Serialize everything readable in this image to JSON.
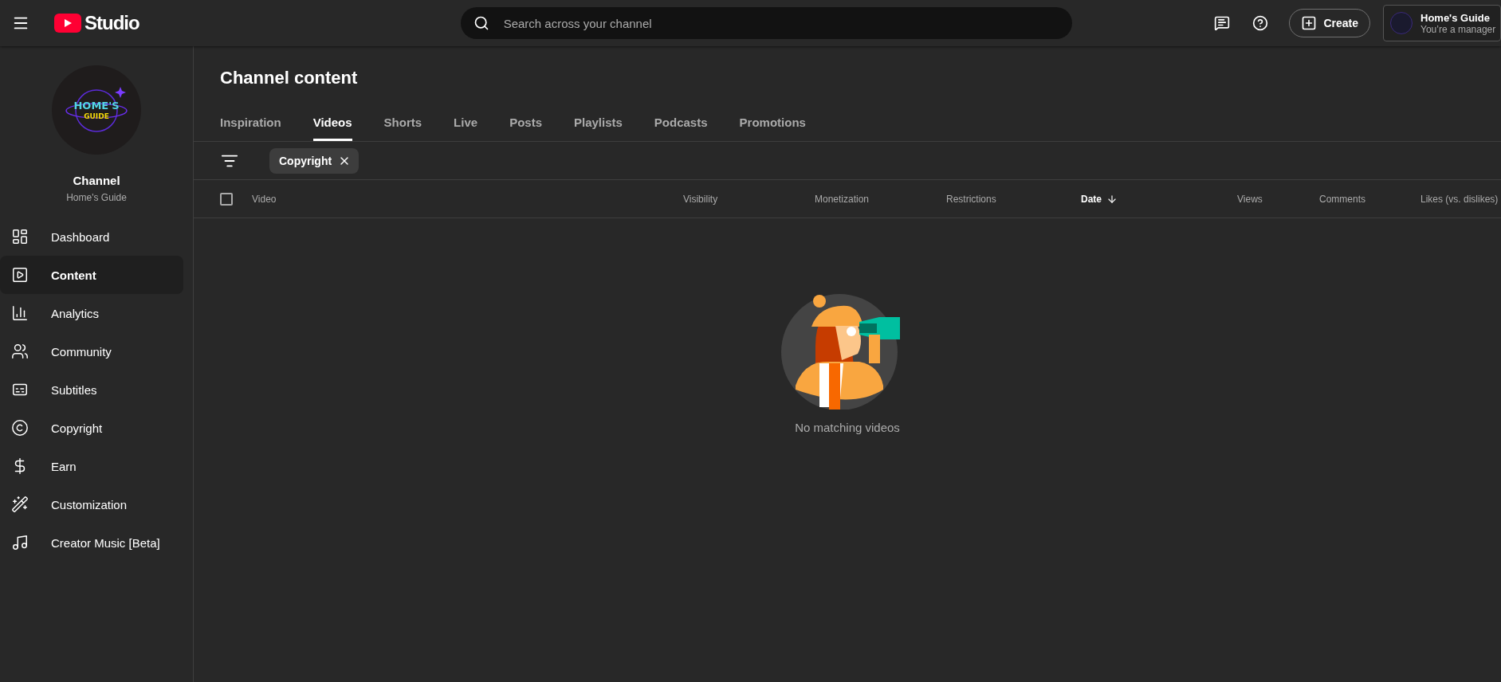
{
  "topbar": {
    "logo_text": "Studio",
    "search": {
      "placeholder": "Search across your channel"
    },
    "create_label": "Create",
    "account": {
      "name": "Home's Guide",
      "role": "You’re a manager"
    }
  },
  "sidebar": {
    "avatar_text": "HOME'S",
    "avatar_subtext": "GUIDE",
    "title": "Channel",
    "subtitle": "Home's Guide",
    "items": [
      {
        "label": "Dashboard",
        "kind": "dashboard",
        "selected": false
      },
      {
        "label": "Content",
        "kind": "content",
        "selected": true
      },
      {
        "label": "Analytics",
        "kind": "analytics",
        "selected": false
      },
      {
        "label": "Community",
        "kind": "community",
        "selected": false
      },
      {
        "label": "Subtitles",
        "kind": "subtitles",
        "selected": false
      },
      {
        "label": "Copyright",
        "kind": "copyright",
        "selected": false
      },
      {
        "label": "Earn",
        "kind": "earn",
        "selected": false
      },
      {
        "label": "Customization",
        "kind": "customization",
        "selected": false
      },
      {
        "label": "Creator Music [Beta]",
        "kind": "music",
        "selected": false
      }
    ]
  },
  "page_title": "Channel content",
  "tabs": [
    {
      "label": "Inspiration",
      "selected": false
    },
    {
      "label": "Videos",
      "selected": true
    },
    {
      "label": "Shorts",
      "selected": false
    },
    {
      "label": "Live",
      "selected": false
    },
    {
      "label": "Posts",
      "selected": false
    },
    {
      "label": "Playlists",
      "selected": false
    },
    {
      "label": "Podcasts",
      "selected": false
    },
    {
      "label": "Promotions",
      "selected": false
    }
  ],
  "filters": [
    {
      "label": "Copyright"
    }
  ],
  "table": {
    "select_all_checked": false,
    "columns": [
      {
        "label": "Video",
        "sorted": false
      },
      {
        "label": "Visibility",
        "sorted": false
      },
      {
        "label": "Monetization",
        "sorted": false
      },
      {
        "label": "Restrictions",
        "sorted": false
      },
      {
        "label": "Date",
        "sorted": true
      },
      {
        "label": "Views",
        "sorted": false
      },
      {
        "label": "Comments",
        "sorted": false
      },
      {
        "label": "Likes (vs. dislikes)",
        "sorted": false
      }
    ]
  },
  "empty_message": "No matching videos"
}
